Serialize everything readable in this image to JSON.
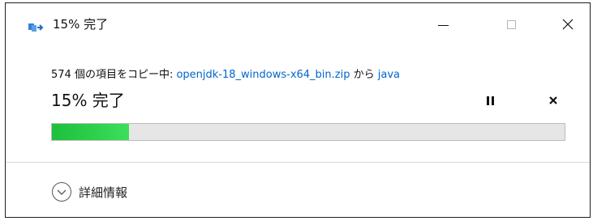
{
  "window": {
    "title": "15% 完了",
    "minimize_icon": "minimize-icon",
    "maximize_icon": "maximize-icon",
    "close_icon": "close-icon"
  },
  "copy": {
    "prefix": "574 個の項目をコピー中: ",
    "source": "openjdk-18_windows-x64_bin.zip",
    "middle": " から ",
    "destination": "java"
  },
  "progress": {
    "label": "15% 完了",
    "percent": 15,
    "pause_icon": "pause-icon",
    "cancel_icon": "cancel-icon"
  },
  "details": {
    "label": "詳細情報",
    "icon": "chevron-down-circle-icon"
  },
  "colors": {
    "progress_fill": "#2fd24c",
    "progress_track": "#e6e6e6",
    "link": "#0066cc"
  }
}
